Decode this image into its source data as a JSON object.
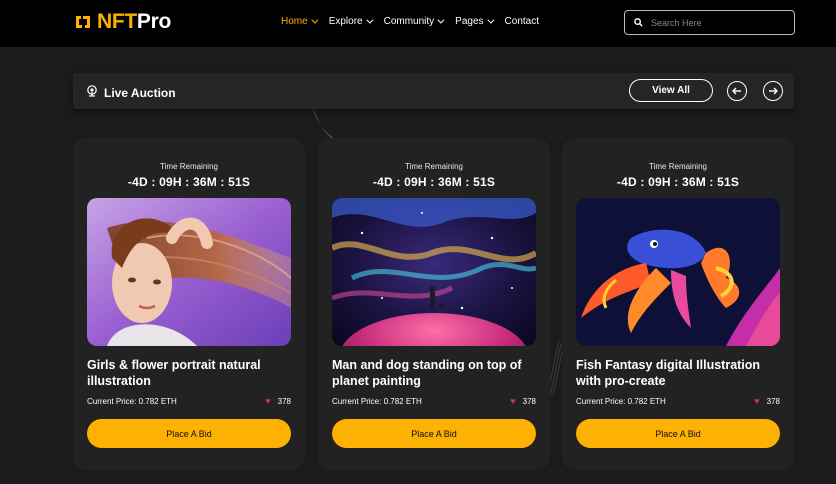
{
  "brand": {
    "name_part1": "NFT",
    "name_part2": "Pro",
    "accent": "#fcb103"
  },
  "nav": {
    "items": [
      {
        "label": "Home",
        "has_dropdown": true,
        "active": true
      },
      {
        "label": "Explore",
        "has_dropdown": true,
        "active": false
      },
      {
        "label": "Community",
        "has_dropdown": true,
        "active": false
      },
      {
        "label": "Pages",
        "has_dropdown": true,
        "active": false
      },
      {
        "label": "Contact",
        "has_dropdown": false,
        "active": false
      }
    ]
  },
  "search": {
    "placeholder": "Search Here",
    "value": "",
    "icon": "search-icon"
  },
  "section": {
    "title": "Live Auction",
    "icon": "live-broadcast-icon",
    "view_all_label": "View All",
    "prev_icon": "arrow-left-icon",
    "next_icon": "arrow-right-icon"
  },
  "cards": [
    {
      "time_label": "Time Remaining",
      "countdown": "-4D : 09H : 36M : 51S",
      "image": "girl-portrait-artwork",
      "title": "Girls & flower portrait natural illustration",
      "price": "Current Price: 0.782 ETH",
      "likes": "378",
      "button_label": "Place A Bid"
    },
    {
      "time_label": "Time Remaining",
      "countdown": "-4D : 09H : 36M : 51S",
      "image": "man-and-dog-planet-artwork",
      "title": "Man and dog standing on top of planet painting",
      "price": "Current Price: 0.782 ETH",
      "likes": "378",
      "button_label": "Place A Bid"
    },
    {
      "time_label": "Time Remaining",
      "countdown": "-4D : 09H : 36M : 51S",
      "image": "fish-fantasy-artwork",
      "title": "Fish Fantasy digital Illustration with pro-create",
      "price": "Current Price: 0.782 ETH",
      "likes": "378",
      "button_label": "Place A Bid"
    }
  ]
}
